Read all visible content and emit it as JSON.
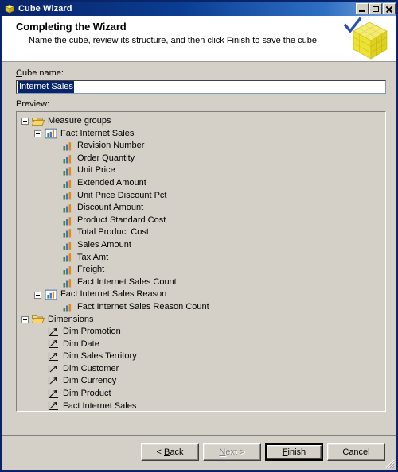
{
  "window": {
    "title": "Cube Wizard",
    "title_icon": "cube-icon",
    "controls": [
      {
        "name": "minimize-button",
        "glyph": "_"
      },
      {
        "name": "maximize-button",
        "glyph": "□"
      },
      {
        "name": "close-button",
        "glyph": "×"
      }
    ]
  },
  "header": {
    "title": "Completing the Wizard",
    "subtitle": "Name the cube, review its structure, and then click Finish to save the cube.",
    "graphic": "yellow-cube-with-checkmark-icon"
  },
  "form": {
    "cube_name_label": "Cube name:",
    "cube_name_label_accesskey": "C",
    "cube_name_value": "Internet Sales",
    "cube_name_selected": true,
    "preview_label": "Preview:"
  },
  "tree": [
    {
      "level": 0,
      "icon": "open-folder-icon",
      "label": "Measure groups",
      "expander": "minus"
    },
    {
      "level": 1,
      "icon": "measure-group-icon",
      "label": "Fact Internet Sales",
      "expander": "minus"
    },
    {
      "level": 2,
      "icon": "measure-icon",
      "label": "Revision Number"
    },
    {
      "level": 2,
      "icon": "measure-icon",
      "label": "Order Quantity"
    },
    {
      "level": 2,
      "icon": "measure-icon",
      "label": "Unit Price"
    },
    {
      "level": 2,
      "icon": "measure-icon",
      "label": "Extended Amount"
    },
    {
      "level": 2,
      "icon": "measure-icon",
      "label": "Unit Price Discount Pct"
    },
    {
      "level": 2,
      "icon": "measure-icon",
      "label": "Discount Amount"
    },
    {
      "level": 2,
      "icon": "measure-icon",
      "label": "Product Standard Cost"
    },
    {
      "level": 2,
      "icon": "measure-icon",
      "label": "Total Product Cost"
    },
    {
      "level": 2,
      "icon": "measure-icon",
      "label": "Sales Amount"
    },
    {
      "level": 2,
      "icon": "measure-icon",
      "label": "Tax Amt"
    },
    {
      "level": 2,
      "icon": "measure-icon",
      "label": "Freight"
    },
    {
      "level": 2,
      "icon": "measure-icon",
      "label": "Fact Internet Sales Count"
    },
    {
      "level": 1,
      "icon": "measure-group-icon",
      "label": "Fact Internet Sales Reason",
      "expander": "minus"
    },
    {
      "level": 2,
      "icon": "measure-icon",
      "label": "Fact Internet Sales Reason Count"
    },
    {
      "level": 0,
      "icon": "open-folder-icon",
      "label": "Dimensions",
      "expander": "minus"
    },
    {
      "level": 1,
      "icon": "dimension-icon",
      "label": "Dim Promotion"
    },
    {
      "level": 1,
      "icon": "dimension-icon",
      "label": "Dim Date"
    },
    {
      "level": 1,
      "icon": "dimension-icon",
      "label": "Dim Sales Territory"
    },
    {
      "level": 1,
      "icon": "dimension-icon",
      "label": "Dim Customer"
    },
    {
      "level": 1,
      "icon": "dimension-icon",
      "label": "Dim Currency"
    },
    {
      "level": 1,
      "icon": "dimension-icon",
      "label": "Dim Product"
    },
    {
      "level": 1,
      "icon": "dimension-icon",
      "label": "Fact Internet Sales"
    }
  ],
  "buttons": {
    "back": {
      "label": "< Back",
      "accesskey": "B",
      "prefix": "< ",
      "key": "B",
      "suffix": "ack",
      "disabled": false,
      "default": false
    },
    "next": {
      "label": "Next >",
      "prefix": "",
      "key": "N",
      "suffix": "ext >",
      "disabled": true,
      "default": false
    },
    "finish": {
      "label": "Finish",
      "prefix": "",
      "key": "F",
      "suffix": "inish",
      "disabled": false,
      "default": true
    },
    "cancel": {
      "label": "Cancel",
      "prefix": "",
      "key": "",
      "suffix": "Cancel",
      "disabled": false,
      "default": false
    }
  },
  "colors": {
    "titlebar_start": "#0a246a",
    "titlebar_end": "#7fa8dc",
    "dialog_face": "#d4d0c8",
    "selection": "#0a246a",
    "header_bg": "#ffffff",
    "cube_yellow": "#f2e534",
    "check_blue": "#2a4fb5"
  }
}
